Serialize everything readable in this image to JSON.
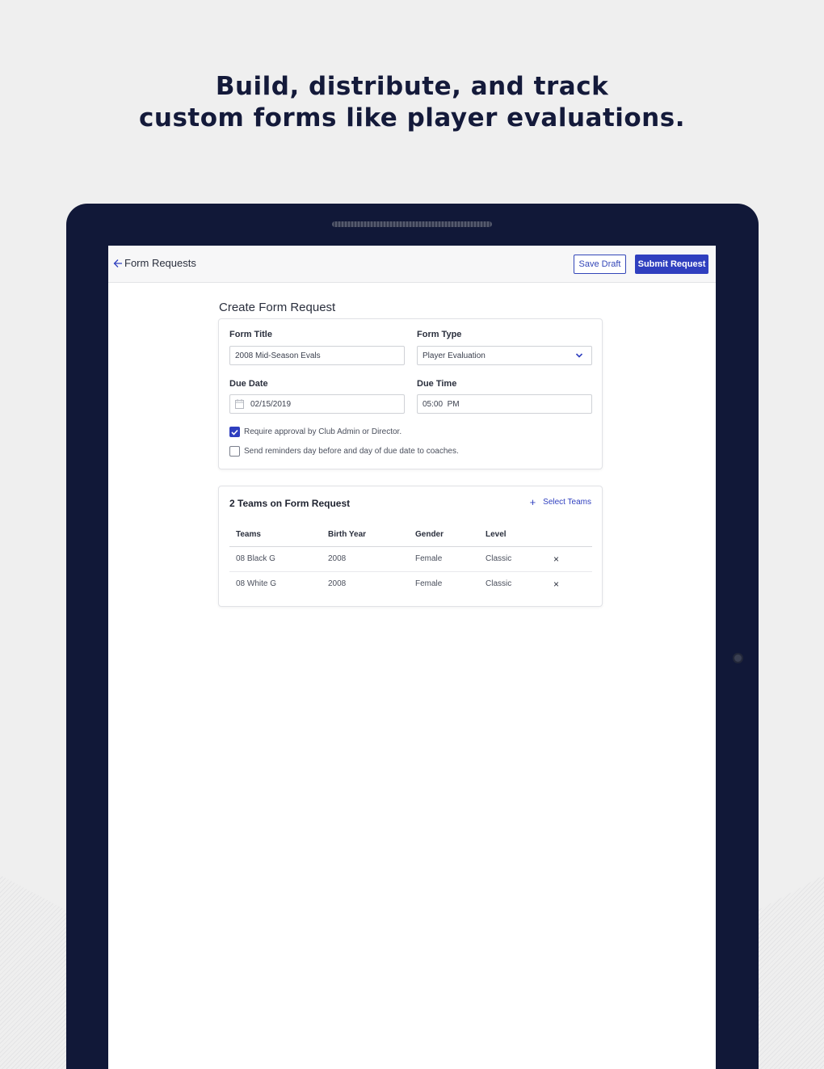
{
  "headline": {
    "line1": "Build, distribute, and track",
    "line2": "custom forms like player evaluations."
  },
  "topbar": {
    "back_label": "Form Requests",
    "save_draft": "Save Draft",
    "submit": "Submit Request"
  },
  "form": {
    "section_title": "Create Form Request",
    "form_title_label": "Form Title",
    "form_title_value": "2008 Mid-Season Evals",
    "form_type_label": "Form Type",
    "form_type_value": "Player Evaluation",
    "due_date_label": "Due Date",
    "due_date_value": "02/15/2019",
    "due_time_label": "Due Time",
    "due_time_value": "05:00  PM",
    "require_approval": {
      "label": "Require approval by Club Admin or Director.",
      "checked": true
    },
    "send_reminders": {
      "label": "Send reminders day before and day of due date to coaches.",
      "checked": false
    }
  },
  "teams": {
    "title": "2 Teams on Form Request",
    "select_label": "Select Teams",
    "columns": [
      "Teams",
      "Birth Year",
      "Gender",
      "Level"
    ],
    "rows": [
      [
        "08 Black G",
        "2008",
        "Female",
        "Classic"
      ],
      [
        "08 White G",
        "2008",
        "Female",
        "Classic"
      ]
    ],
    "remove_glyph": "×"
  },
  "colors": {
    "accent": "#2f3fbf",
    "device": "#111838",
    "headline": "#141a3a"
  }
}
